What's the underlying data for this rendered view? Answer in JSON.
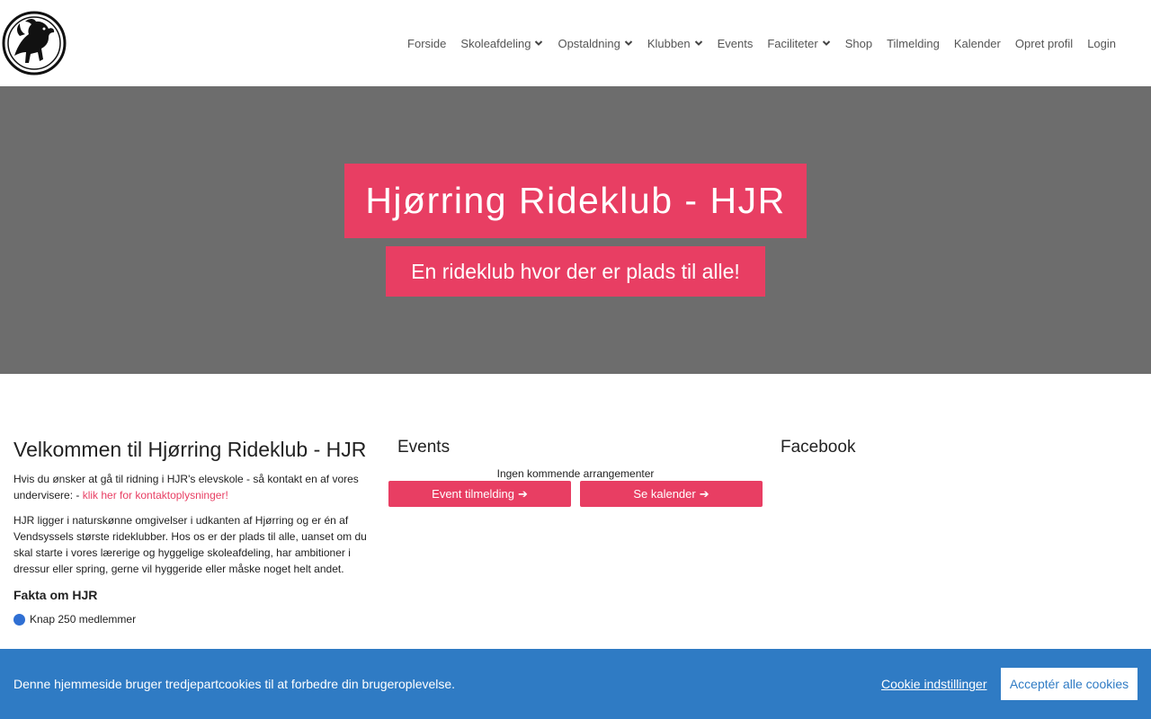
{
  "header": {
    "logo_icon": "horse-crest-logo-icon",
    "nav": [
      {
        "label": "Forside",
        "dropdown": false
      },
      {
        "label": "Skoleafdeling",
        "dropdown": true
      },
      {
        "label": "Opstaldning",
        "dropdown": true
      },
      {
        "label": "Klubben",
        "dropdown": true
      },
      {
        "label": "Events",
        "dropdown": false
      },
      {
        "label": "Faciliteter",
        "dropdown": true
      },
      {
        "label": "Shop",
        "dropdown": false
      },
      {
        "label": "Tilmelding",
        "dropdown": false
      },
      {
        "label": "Kalender",
        "dropdown": false
      },
      {
        "label": "Opret profil",
        "dropdown": false
      },
      {
        "label": "Login",
        "dropdown": false
      }
    ]
  },
  "hero": {
    "title": "Hjørring Rideklub - HJR",
    "subtitle": "En rideklub hvor der er plads til alle!"
  },
  "welcome": {
    "heading": "Velkommen til Hjørring Rideklub - HJR",
    "intro_text": "Hvis du ønsker at gå til ridning i HJR's elevskole - så kontakt en af vores undervisere:   - ",
    "contact_link": "klik her for kontaktoplysninger!",
    "description": "HJR ligger i naturskønne omgivelser i udkanten af Hjørring og er én af Vendsyssels største rideklubber. Hos os er der plads til alle, uanset om du skal starte i vores lærerige og hyggelige skoleafdeling, har ambitioner i dressur eller spring, gerne vil hyggeride eller måske noget helt andet.",
    "facts_heading": "Fakta om HJR",
    "facts": [
      "Knap 250 medlemmer"
    ]
  },
  "events": {
    "heading": "Events",
    "empty_text": "Ingen kommende arrangementer",
    "signup_button": "Event tilmelding",
    "calendar_button": "Se kalender",
    "button_icon": "arrow-right-icon"
  },
  "facebook": {
    "heading": "Facebook"
  },
  "cookie": {
    "text": "Denne hjemmeside bruger tredjepartcookies til at forbedre din brugeroplevelse.",
    "settings_label": "Cookie indstillinger",
    "accept_label": "Acceptér alle cookies"
  },
  "colors": {
    "accent": "#e83e63",
    "hero_bg": "#6d6d6d",
    "cookie_bg": "#2f7bc4"
  }
}
